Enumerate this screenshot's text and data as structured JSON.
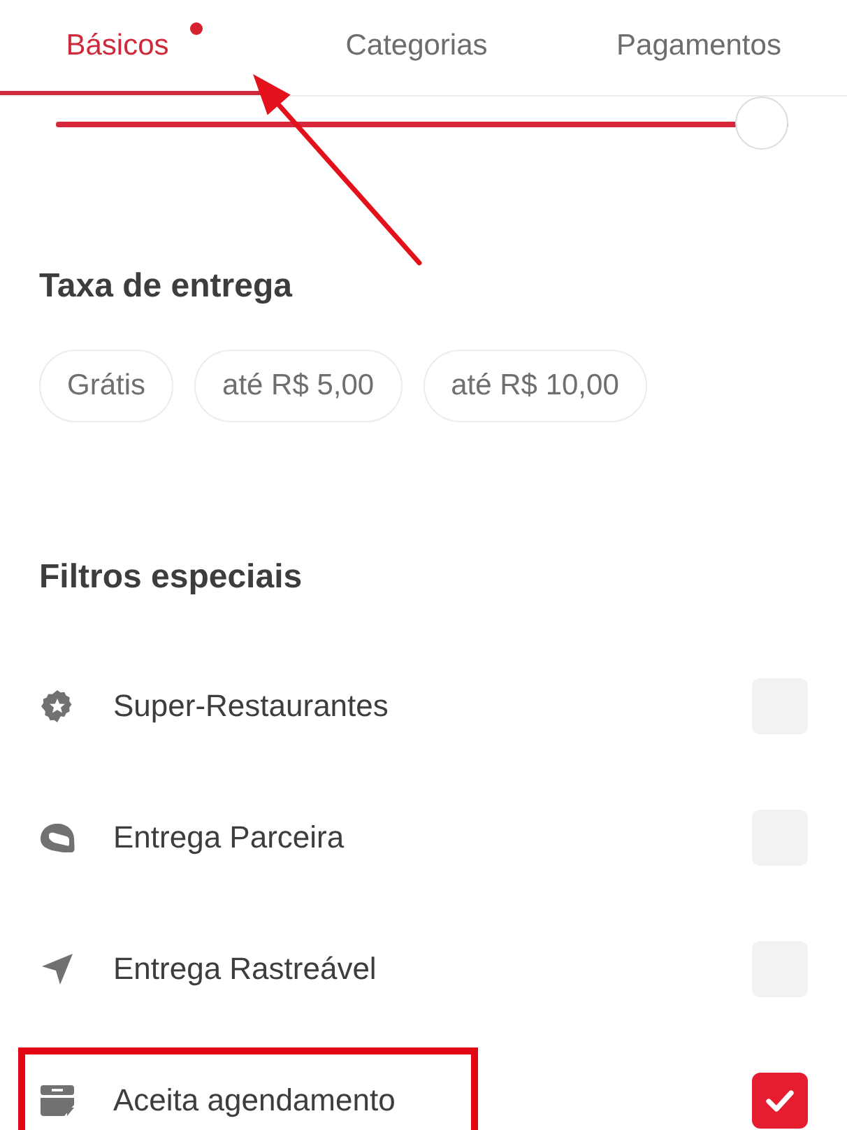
{
  "tabs": [
    {
      "label": "Básicos",
      "selected": true,
      "dot": true
    },
    {
      "label": "Categorias",
      "selected": false,
      "dot": false
    },
    {
      "label": "Pagamentos",
      "selected": false,
      "dot": false
    }
  ],
  "annotation_arrow": true,
  "distance_slider": {
    "level": 1.0
  },
  "delivery_fee": {
    "title": "Taxa de entrega",
    "options": [
      {
        "label": "Grátis",
        "selected": false
      },
      {
        "label": "até R$ 5,00",
        "selected": false
      },
      {
        "label": "até R$ 10,00",
        "selected": false
      }
    ]
  },
  "special_filters": {
    "title": "Filtros especiais",
    "items": [
      {
        "kind": "star",
        "label": "Super-Restaurantes",
        "checked": false,
        "highlighted": false
      },
      {
        "kind": "helmet",
        "label": "Entrega Parceira",
        "checked": false,
        "highlighted": false
      },
      {
        "kind": "navigation",
        "label": "Entrega Rastreável",
        "checked": false,
        "highlighted": false
      },
      {
        "kind": "calendar",
        "label": "Aceita agendamento",
        "checked": true,
        "highlighted": true
      }
    ]
  }
}
